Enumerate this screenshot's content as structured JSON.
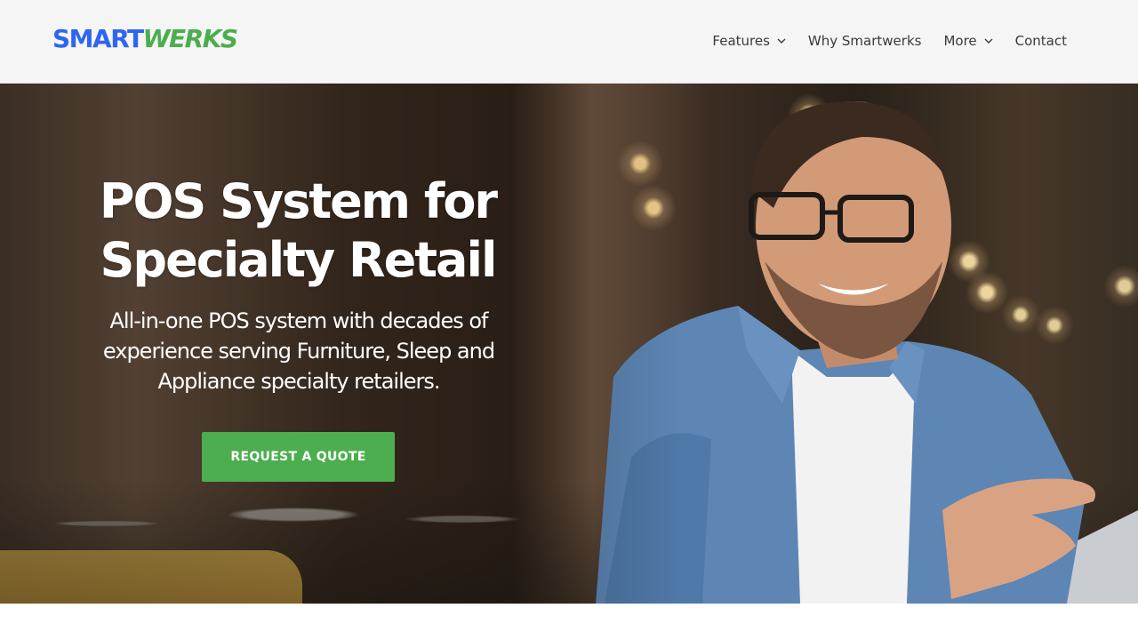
{
  "brand": {
    "logo_part1": "SMART",
    "logo_part2": "WERKS",
    "colors": {
      "blue": "#2f66f0",
      "green": "#4cad4f"
    }
  },
  "nav": {
    "items": [
      {
        "label": "Features",
        "has_dropdown": true,
        "icon": "chevron-down-icon"
      },
      {
        "label": "Why Smartwerks",
        "has_dropdown": false
      },
      {
        "label": "More",
        "has_dropdown": true,
        "icon": "chevron-down-icon"
      },
      {
        "label": "Contact",
        "has_dropdown": false
      }
    ]
  },
  "hero": {
    "title_line1": "POS System for",
    "title_line2": "Specialty Retail",
    "subtitle": "All-in-one POS system with decades of experience serving Furniture, Sleep and Appliance specialty retailers.",
    "cta_label": "REQUEST A QUOTE",
    "cta_color": "#4cae4f"
  }
}
